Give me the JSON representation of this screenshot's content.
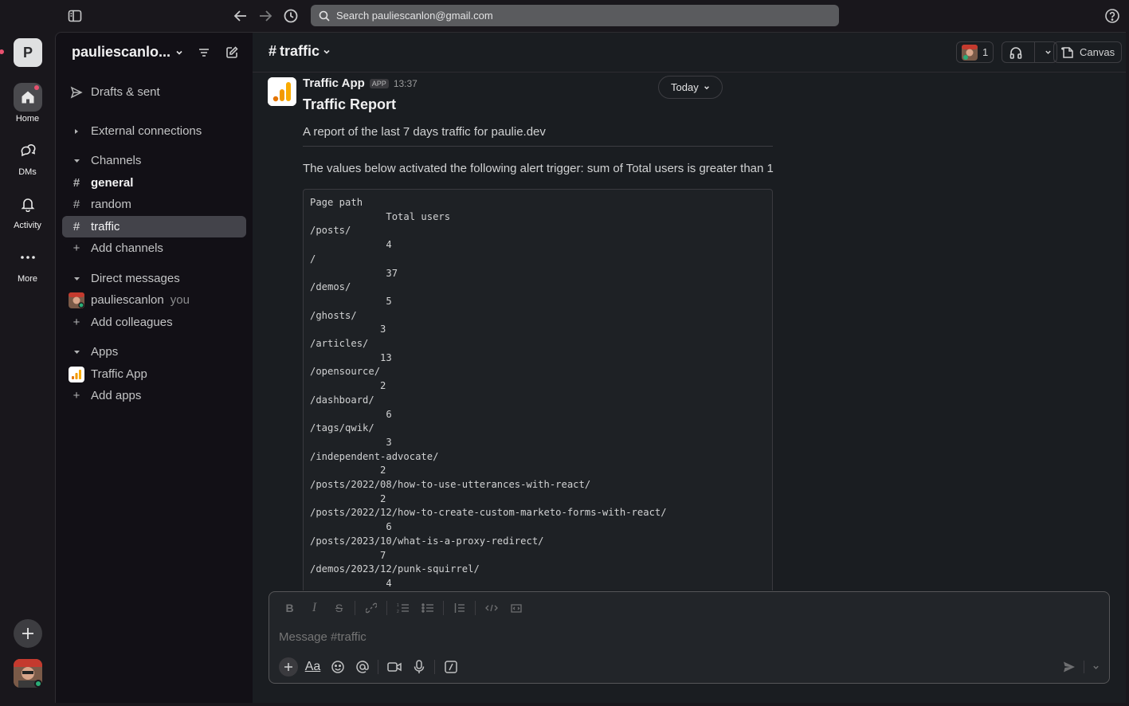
{
  "topbar": {
    "search_placeholder": "Search pauliescanlon@gmail.com"
  },
  "rail": {
    "workspace_initial": "P",
    "items": [
      {
        "label": "Home",
        "icon": "home-icon"
      },
      {
        "label": "DMs",
        "icon": "dms-icon"
      },
      {
        "label": "Activity",
        "icon": "bell-icon"
      },
      {
        "label": "More",
        "icon": "more-icon"
      }
    ]
  },
  "sidebar": {
    "workspace_name": "pauliescanlo...",
    "drafts_label": "Drafts & sent",
    "external_label": "External connections",
    "channels_header": "Channels",
    "channels": [
      "general",
      "random",
      "traffic"
    ],
    "active_channel": "traffic",
    "add_channels": "Add channels",
    "dm_header": "Direct messages",
    "dm_user": "pauliescanlon",
    "dm_you": "you",
    "add_colleagues": "Add colleagues",
    "apps_header": "Apps",
    "app_name": "Traffic App",
    "add_apps": "Add apps"
  },
  "header": {
    "channel_name": "traffic",
    "member_count": "1",
    "canvas_label": "Canvas"
  },
  "message": {
    "sender": "Traffic App",
    "badge": "APP",
    "time": "13:37",
    "date_pill": "Today",
    "title": "Traffic Report",
    "description": "A report of the last 7 days traffic for paulie.dev",
    "alert": "The values below activated the following alert trigger: sum of Total users is greater than 1",
    "table_header": {
      "path": "Page path",
      "users": "Total users"
    },
    "rows": [
      {
        "path": "/posts/",
        "users": "4",
        "indent": "             "
      },
      {
        "path": "/",
        "users": "37",
        "indent": "             "
      },
      {
        "path": "/demos/",
        "users": "5",
        "indent": "             "
      },
      {
        "path": "/ghosts/",
        "users": "3",
        "indent": "            "
      },
      {
        "path": "/articles/",
        "users": "13",
        "indent": "            "
      },
      {
        "path": "/opensource/",
        "users": "2",
        "indent": "            "
      },
      {
        "path": "/dashboard/",
        "users": "6",
        "indent": "             "
      },
      {
        "path": "/tags/qwik/",
        "users": "3",
        "indent": "             "
      },
      {
        "path": "/independent-advocate/",
        "users": "2",
        "indent": "            "
      },
      {
        "path": "/posts/2022/08/how-to-use-utterances-with-react/",
        "users": "2",
        "indent": "            "
      },
      {
        "path": "/posts/2022/12/how-to-create-custom-marketo-forms-with-react/",
        "users": "6",
        "indent": "             "
      },
      {
        "path": "/posts/2023/10/what-is-a-proxy-redirect/",
        "users": "7",
        "indent": "            "
      },
      {
        "path": "/demos/2023/12/punk-squirrel/",
        "users": "4",
        "indent": "             "
      }
    ]
  },
  "composer": {
    "placeholder": "Message #traffic",
    "format_aa": "Aa"
  },
  "colors": {
    "app_bg": "#19171c",
    "sidebar_bg": "#121016",
    "main_bg": "#1a1d21",
    "active_row": "#43434a",
    "online": "#2bac76",
    "notification": "#e8516f",
    "traffic_orange": "#f29900"
  }
}
